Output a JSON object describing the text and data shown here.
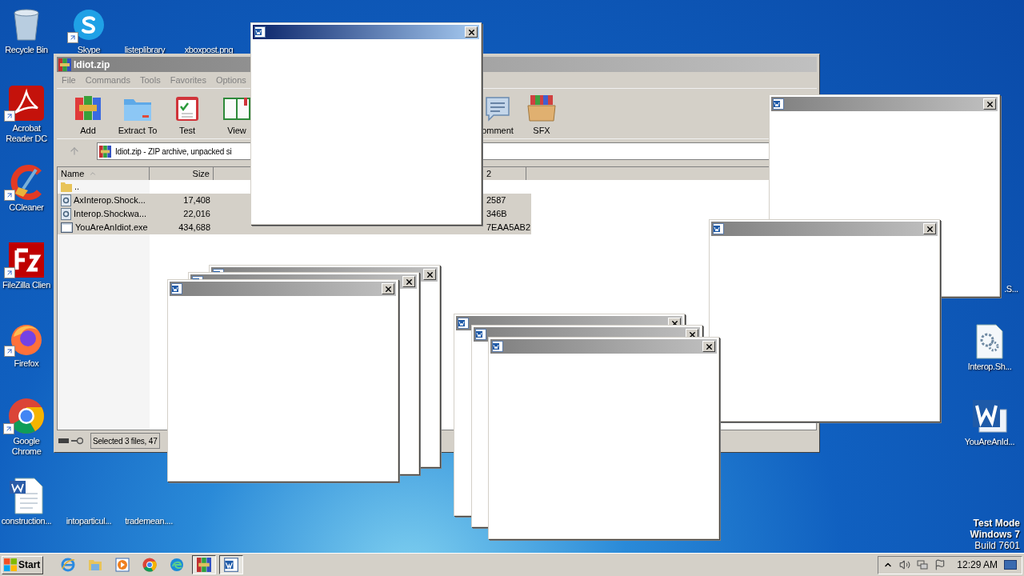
{
  "desktop_icons": [
    {
      "label": "Recycle Bin",
      "kind": "recycle",
      "shortcut": false
    },
    {
      "label": "Skype",
      "kind": "skype",
      "shortcut": true
    },
    {
      "label": "listeplibrary",
      "kind": "blank",
      "shortcut": false
    },
    {
      "label": "xboxpost.png",
      "kind": "blank",
      "shortcut": false
    },
    {
      "label": "Acrobat Reader DC",
      "kind": "acrobat",
      "shortcut": true
    },
    {
      "label": "CCleaner",
      "kind": "ccleaner",
      "shortcut": true
    },
    {
      "label": "FileZilla Clien",
      "kind": "filezilla",
      "shortcut": true
    },
    {
      "label": "Firefox",
      "kind": "firefox",
      "shortcut": true
    },
    {
      "label": "Google Chrome",
      "kind": "chrome",
      "shortcut": true
    },
    {
      "label": "construction...",
      "kind": "word-doc",
      "shortcut": false
    },
    {
      "label": "intoparticul...",
      "kind": "blank",
      "shortcut": false
    },
    {
      "label": "trademean....",
      "kind": "blank",
      "shortcut": false
    },
    {
      "label": ".S...",
      "kind": "hidden",
      "shortcut": false
    },
    {
      "label": "Interop.Sh...",
      "kind": "gear-doc",
      "shortcut": false
    },
    {
      "label": "YouAreAnId...",
      "kind": "word",
      "shortcut": false
    }
  ],
  "archive_window": {
    "title": "Idiot.zip",
    "menu": [
      "File",
      "Commands",
      "Tools",
      "Favorites",
      "Options"
    ],
    "toolbar": [
      {
        "label": "Add",
        "kind": "add"
      },
      {
        "label": "Extract To",
        "kind": "extract"
      },
      {
        "label": "Test",
        "kind": "test"
      },
      {
        "label": "View",
        "kind": "view"
      },
      {
        "label": "omment",
        "kind": "comment"
      },
      {
        "label": "SFX",
        "kind": "sfx"
      }
    ],
    "address": "Idiot.zip - ZIP archive, unpacked si",
    "columns": [
      {
        "label": "Name",
        "sorted": true
      },
      {
        "label": "Size",
        "sorted": false
      },
      {
        "label": "2",
        "sorted": false
      }
    ],
    "rows": [
      {
        "name": "..",
        "kind": "folder",
        "size": "",
        "column_3": "",
        "selected": false
      },
      {
        "name": "AxInterop.Shock...",
        "kind": "dll",
        "size": "17,408",
        "column_3": "2587",
        "selected": true
      },
      {
        "name": "Interop.Shockwa...",
        "kind": "dll",
        "size": "22,016",
        "column_3": "346B",
        "selected": true
      },
      {
        "name": "YouAreAnIdiot.exe",
        "kind": "exe",
        "size": "434,688",
        "column_3": "7EAA5AB2",
        "selected": true
      }
    ],
    "status": "Selected 3 files, 47"
  },
  "popups": [
    {
      "active": true
    },
    {
      "active": false
    },
    {
      "active": false
    },
    {
      "active": false
    },
    {
      "active": false
    },
    {
      "active": false
    },
    {
      "active": false
    },
    {
      "active": false
    },
    {
      "active": false
    }
  ],
  "taskbar": {
    "start": "Start",
    "items": [
      {
        "kind": "ie",
        "selected": false
      },
      {
        "kind": "explorer",
        "selected": false
      },
      {
        "kind": "media",
        "selected": false
      },
      {
        "kind": "chrome",
        "selected": false
      },
      {
        "kind": "edge",
        "selected": false
      },
      {
        "kind": "winrar",
        "selected": true
      },
      {
        "kind": "word",
        "selected": true
      }
    ],
    "clock": "12:29 AM"
  },
  "system_notice": [
    "Test Mode",
    "Windows 7",
    "Build 7601"
  ]
}
